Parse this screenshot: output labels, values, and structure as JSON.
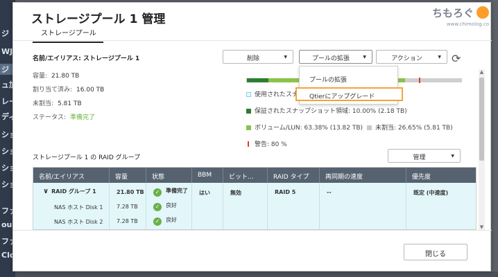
{
  "background_sidebar": {
    "items": [
      "ジ",
      "WJE",
      "ジ",
      "ュ加",
      "レー",
      "ディ",
      "ショ",
      "ショ",
      "ショ",
      "ショ",
      "ファ",
      "ount",
      "ファ",
      "Clou"
    ]
  },
  "dialog": {
    "title": "ストレージプール 1 管理",
    "close_glyph": "×",
    "tab": "ストレージプール"
  },
  "watermark": {
    "main": "ちもろぐ",
    "sub": "www.chimolog.co"
  },
  "pool": {
    "name_label": "名前/エイリアス: ストレージプール 1",
    "capacity_label": "容量:",
    "capacity": "21.80 TB",
    "allocated_label": "割り当て済み:",
    "allocated": "16.00 TB",
    "unallocated_label": "未割当:",
    "unallocated": "5.81 TB",
    "status_label": "ステータス:",
    "status": "準備完了"
  },
  "toolbar": {
    "delete": "削除",
    "expand": "プールの拡張",
    "action": "アクション",
    "refresh_icon": "refresh-icon"
  },
  "expand_menu": {
    "items": [
      "プールの拡張",
      "Qtierにアップグレード"
    ],
    "highlight_color": "#f2a43a"
  },
  "usage": {
    "used_fraction": 0.0035,
    "snapshot_fraction": 0.1,
    "volume_fraction": 0.6338,
    "warning_fraction": 0.8,
    "legend": {
      "used": "使用されたスナ",
      "snapshot": "保証されたスナップショット領域: 10.00% (2.18 TB)",
      "volume": "ボリューム/LUN: 63.38% (13.82 TB)",
      "unallocated": "未割当: 26.65% (5.81 TB)",
      "warning": "警告: 80 %"
    },
    "colors": {
      "snapshot": "#2e7d32",
      "volume": "#8bc34a",
      "unallocated": "#cfcfcf",
      "warning": "#e53935"
    }
  },
  "raid": {
    "title": "ストレージプール 1 の RAID グループ",
    "manage": "管理",
    "headers": [
      "名前/エイリアス",
      "容量",
      "状態",
      "BBM",
      "ビット...",
      "RAID タイプ",
      "再同期の速度",
      "優先度"
    ],
    "group": {
      "name": "RAID グループ 1",
      "capacity": "21.80 TB",
      "status": "準備完了",
      "bbm": "はい",
      "bitmap": "無効",
      "raid_type": "RAID 5",
      "resync": "--",
      "priority": "既定 (中速度)"
    },
    "disks": [
      {
        "name": "NAS ホスト Disk 1",
        "capacity": "7.28 TB",
        "status": "良好"
      },
      {
        "name": "NAS ホスト Disk 2",
        "capacity": "7.28 TB",
        "status": "良好"
      }
    ]
  },
  "footer": {
    "close": "閉じる"
  }
}
